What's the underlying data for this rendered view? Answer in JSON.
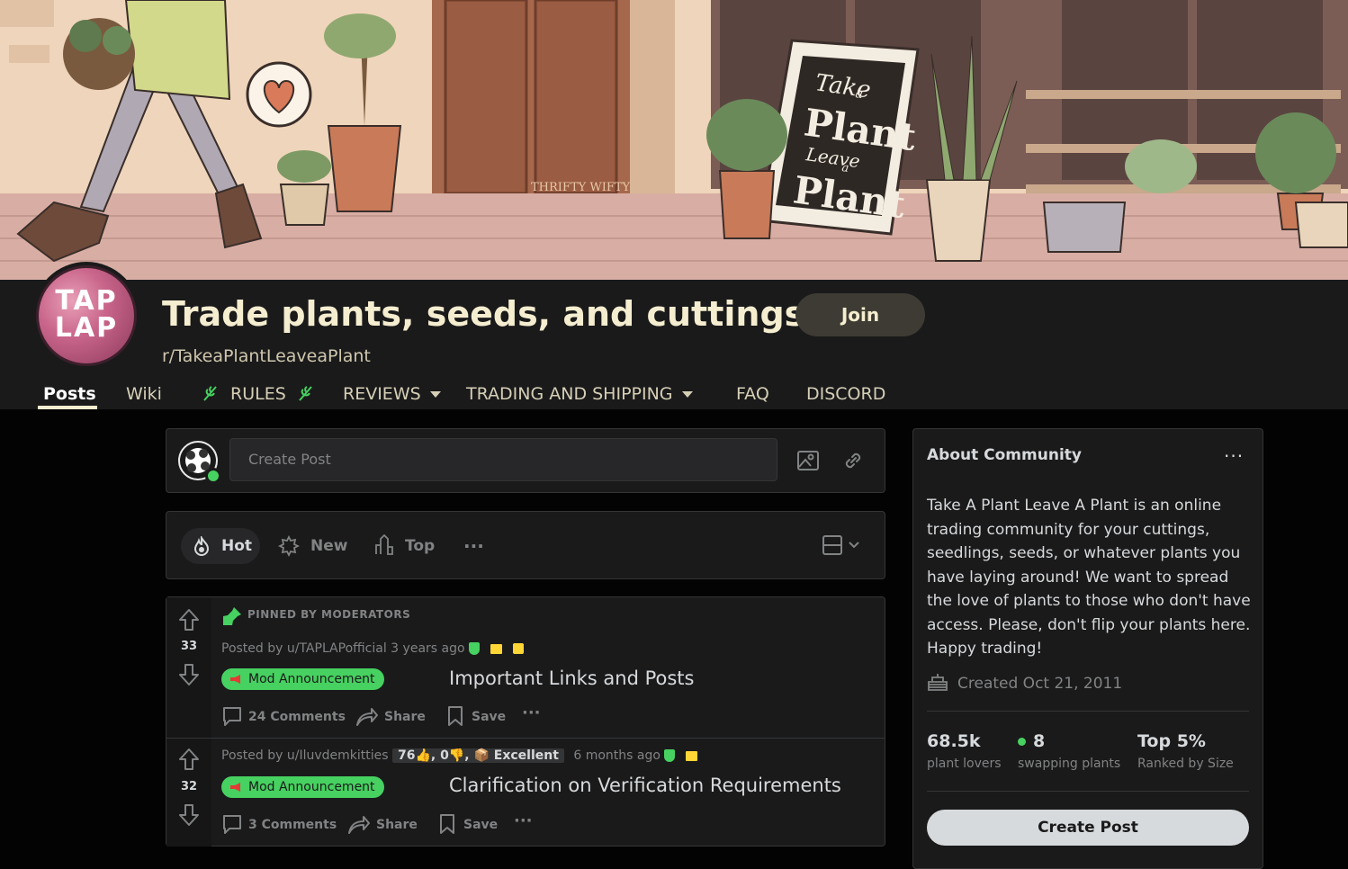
{
  "banner": {
    "sign_line1": "Take",
    "sign_line2": "a",
    "sign_line3": "Plant",
    "sign_line4": "Leave",
    "sign_line5": "a",
    "sign_line6": "Plant",
    "signature": "THRIFTY WIFTY"
  },
  "community": {
    "avatar_text_1": "TAP",
    "avatar_text_2": "LAP",
    "title": "Trade plants, seeds, and cuttings!",
    "name": "r/TakeaPlantLeaveaPlant",
    "join_label": "Join"
  },
  "nav": {
    "posts": "Posts",
    "wiki": "Wiki",
    "rules": "RULES",
    "reviews": "REVIEWS",
    "trading": "TRADING AND SHIPPING",
    "faq": "FAQ",
    "discord": "DISCORD"
  },
  "create_post": {
    "placeholder": "Create Post"
  },
  "sort": {
    "hot": "Hot",
    "new": "New",
    "top": "Top",
    "more": "···"
  },
  "posts": [
    {
      "pinned_label": "PINNED BY MODERATORS",
      "score": "33",
      "meta": "Posted by u/TAPLAPofficial 3 years ago",
      "flair": "Mod Announcement",
      "title": "Important Links and Posts",
      "comments": "24 Comments",
      "share": "Share",
      "save": "Save",
      "more": "···"
    },
    {
      "score": "32",
      "meta_prefix": "Posted by u/Iluvdemkitties",
      "user_flair": "76👍, 0👎, 📦 Excellent",
      "meta_suffix": "6 months ago",
      "flair": "Mod Announcement",
      "title": "Clarification on Verification Requirements",
      "comments": "3 Comments",
      "share": "Share",
      "save": "Save",
      "more": "···"
    }
  ],
  "about": {
    "title": "About Community",
    "more": "···",
    "description": "Take A Plant Leave A Plant is an online trading community for your cuttings, seedlings, seeds, or whatever plants you have laying around! We want to spread the love of plants to those who don't have access. Please, don't flip your plants here. Happy trading!",
    "created": "Created Oct 21, 2011",
    "stats": [
      {
        "value": "68.5k",
        "label": "plant lovers"
      },
      {
        "value": "8",
        "label": "swapping plants"
      },
      {
        "value": "Top 5%",
        "label": "Ranked by Size"
      }
    ],
    "create_post_label": "Create Post"
  },
  "colors": {
    "accent_green": "#46d160",
    "title_cream": "#f5edcf",
    "background": "#030303",
    "card": "#1a1a1b"
  }
}
